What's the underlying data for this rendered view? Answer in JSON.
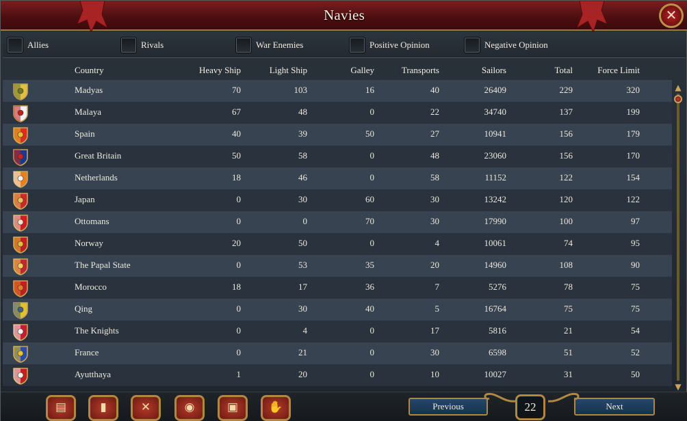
{
  "window": {
    "title": "Navies",
    "close_icon": "close-icon"
  },
  "filters": [
    {
      "label": "Allies",
      "checked": false
    },
    {
      "label": "Rivals",
      "checked": false
    },
    {
      "label": "War Enemies",
      "checked": false
    },
    {
      "label": "Positive Opinion",
      "checked": false
    },
    {
      "label": "Negative Opinion",
      "checked": false
    }
  ],
  "columns": [
    "Country",
    "Heavy Ship",
    "Light Ship",
    "Galley",
    "Transports",
    "Sailors",
    "Total",
    "Force Limit"
  ],
  "rows": [
    {
      "country": "Madyas",
      "heavy": "70",
      "light": "103",
      "galley": "16",
      "transports": "40",
      "sailors": "26409",
      "total": "229",
      "force_limit": "320",
      "flag": [
        "#e0c040",
        "#6a7a30"
      ]
    },
    {
      "country": "Malaya",
      "heavy": "67",
      "light": "48",
      "galley": "0",
      "transports": "22",
      "sailors": "34740",
      "total": "137",
      "force_limit": "199",
      "flag": [
        "#f2f2f2",
        "#c02020"
      ]
    },
    {
      "country": "Spain",
      "heavy": "40",
      "light": "39",
      "galley": "50",
      "transports": "27",
      "sailors": "10941",
      "total": "156",
      "force_limit": "179",
      "flag": [
        "#d83020",
        "#e8c030"
      ]
    },
    {
      "country": "Great Britain",
      "heavy": "50",
      "light": "58",
      "galley": "0",
      "transports": "48",
      "sailors": "23060",
      "total": "156",
      "force_limit": "170",
      "flag": [
        "#1c3a8a",
        "#d02020"
      ]
    },
    {
      "country": "Netherlands",
      "heavy": "18",
      "light": "46",
      "galley": "0",
      "transports": "58",
      "sailors": "11152",
      "total": "122",
      "force_limit": "154",
      "flag": [
        "#e88020",
        "#f2f2f2"
      ]
    },
    {
      "country": "Japan",
      "heavy": "0",
      "light": "30",
      "galley": "60",
      "transports": "30",
      "sailors": "13242",
      "total": "120",
      "force_limit": "122",
      "flag": [
        "#c82a2a",
        "#e8c060"
      ]
    },
    {
      "country": "Ottomans",
      "heavy": "0",
      "light": "0",
      "galley": "70",
      "transports": "30",
      "sailors": "17990",
      "total": "100",
      "force_limit": "97",
      "flag": [
        "#c82020",
        "#f0e0d0"
      ]
    },
    {
      "country": "Norway",
      "heavy": "20",
      "light": "50",
      "galley": "0",
      "transports": "4",
      "sailors": "10061",
      "total": "74",
      "force_limit": "95",
      "flag": [
        "#c02020",
        "#e0c040"
      ]
    },
    {
      "country": "The Papal State",
      "heavy": "0",
      "light": "53",
      "galley": "35",
      "transports": "20",
      "sailors": "14960",
      "total": "108",
      "force_limit": "90",
      "flag": [
        "#c02830",
        "#f0d060"
      ]
    },
    {
      "country": "Morocco",
      "heavy": "18",
      "light": "17",
      "galley": "36",
      "transports": "7",
      "sailors": "5276",
      "total": "78",
      "force_limit": "75",
      "flag": [
        "#c02020",
        "#e08030"
      ]
    },
    {
      "country": "Qing",
      "heavy": "0",
      "light": "30",
      "galley": "40",
      "transports": "5",
      "sailors": "16764",
      "total": "75",
      "force_limit": "75",
      "flag": [
        "#e0c030",
        "#406090"
      ]
    },
    {
      "country": "The Knights",
      "heavy": "0",
      "light": "4",
      "galley": "0",
      "transports": "17",
      "sailors": "5816",
      "total": "21",
      "force_limit": "54",
      "flag": [
        "#c02030",
        "#f2f2f2"
      ]
    },
    {
      "country": "France",
      "heavy": "0",
      "light": "21",
      "galley": "0",
      "transports": "30",
      "sailors": "6598",
      "total": "51",
      "force_limit": "52",
      "flag": [
        "#2a4ea0",
        "#e8c030"
      ]
    },
    {
      "country": "Ayutthaya",
      "heavy": "1",
      "light": "20",
      "galley": "0",
      "transports": "10",
      "sailors": "10027",
      "total": "31",
      "force_limit": "50",
      "flag": [
        "#c02020",
        "#f2f2f2"
      ]
    }
  ],
  "bottom_tabs": [
    {
      "name": "ledger-tab",
      "icon": "▤"
    },
    {
      "name": "land-forces-tab",
      "icon": "▮"
    },
    {
      "name": "military-tab",
      "icon": "✕"
    },
    {
      "name": "economy-tab",
      "icon": "◉"
    },
    {
      "name": "trade-tab",
      "icon": "▣"
    },
    {
      "name": "diplomacy-tab",
      "icon": "✋"
    }
  ],
  "pagination": {
    "previous_label": "Previous",
    "next_label": "Next",
    "page": "22"
  },
  "colors": {
    "header_red": "#7a1e1e",
    "gold_trim": "#b08844",
    "row_even": "#2a333d",
    "row_odd": "#374350"
  }
}
